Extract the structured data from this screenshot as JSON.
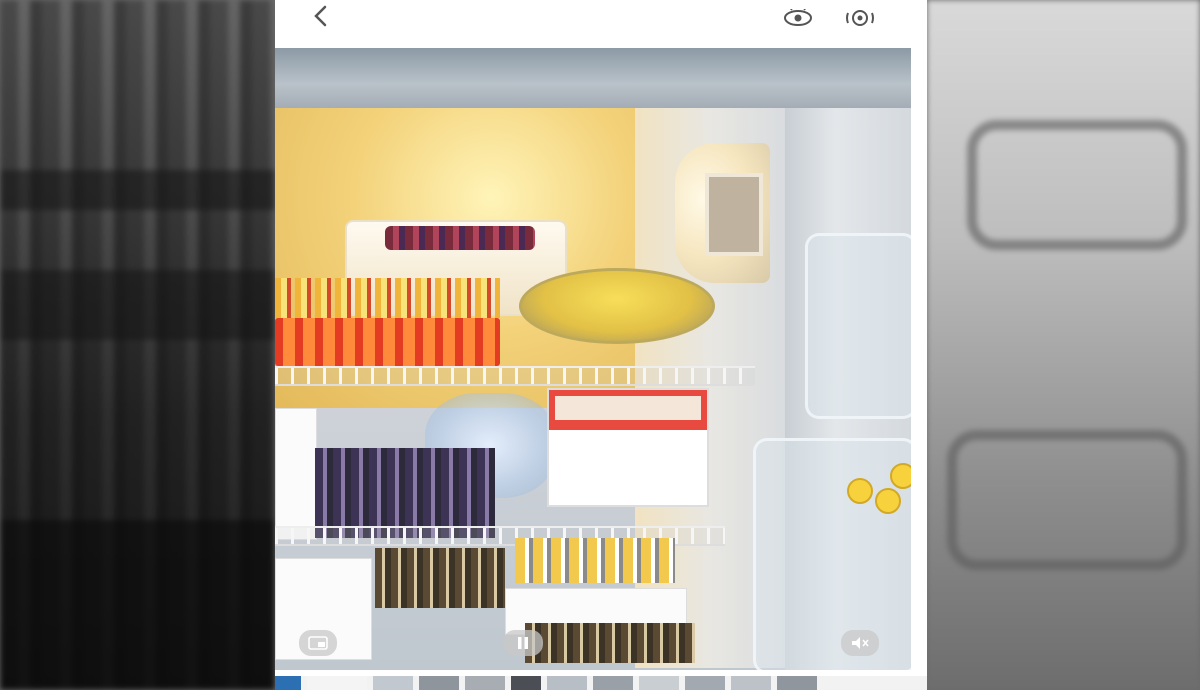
{
  "topbar": {
    "back_icon": "chevron-left-icon",
    "actions": [
      {
        "icon": "eye-icon"
      },
      {
        "icon": "camera-flip-icon"
      }
    ]
  },
  "photo": {
    "subject": "refrigerator",
    "playback_controls": [
      {
        "icon": "picture-in-picture-icon"
      },
      {
        "icon": "pause-icon"
      },
      {
        "icon": "mute-icon"
      }
    ]
  },
  "thumbnails": {
    "count": 12
  },
  "colors": {
    "background_panels": "#6a6a6a",
    "phone_bg": "#ffffff",
    "icon_gray": "#555555",
    "light_warm": "#f5d97a",
    "rack_red": "#e33c22"
  }
}
